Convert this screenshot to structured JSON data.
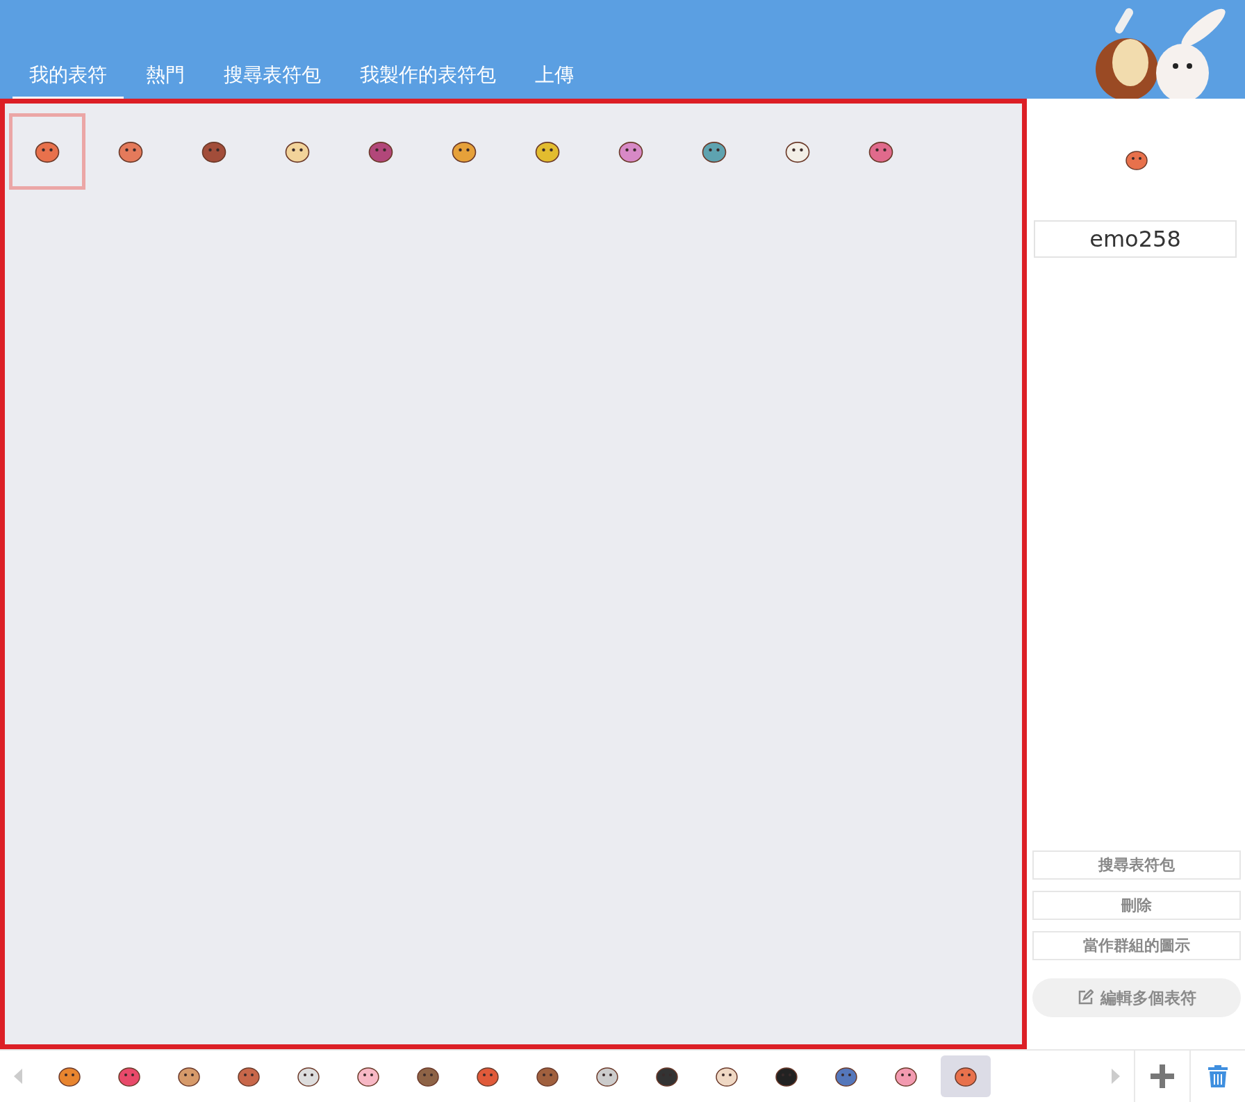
{
  "tabs": [
    {
      "label": "我的表符",
      "selected": true
    },
    {
      "label": "熱門",
      "selected": false
    },
    {
      "label": "搜尋表符包",
      "selected": false
    },
    {
      "label": "我製作的表符包",
      "selected": false
    },
    {
      "label": "上傳",
      "selected": false
    }
  ],
  "stickers": [
    {
      "selected": true
    },
    {
      "selected": false
    },
    {
      "selected": false
    },
    {
      "selected": false
    },
    {
      "selected": false
    },
    {
      "selected": false
    },
    {
      "selected": false
    },
    {
      "selected": false
    },
    {
      "selected": false
    },
    {
      "selected": false
    },
    {
      "selected": false
    }
  ],
  "detail": {
    "name": "emo258",
    "buttons": [
      {
        "label": "搜尋表符包",
        "kind": "plain"
      },
      {
        "label": "刪除",
        "kind": "plain"
      },
      {
        "label": "當作群組的圖示",
        "kind": "plain"
      },
      {
        "label": "編輯多個表符",
        "kind": "edit"
      }
    ]
  },
  "packs": [
    {
      "selected": false
    },
    {
      "selected": false
    },
    {
      "selected": false
    },
    {
      "selected": false
    },
    {
      "selected": false
    },
    {
      "selected": false
    },
    {
      "selected": false
    },
    {
      "selected": false
    },
    {
      "selected": false
    },
    {
      "selected": false
    },
    {
      "selected": false
    },
    {
      "selected": false
    },
    {
      "selected": false
    },
    {
      "selected": false
    },
    {
      "selected": false
    },
    {
      "selected": true
    }
  ]
}
